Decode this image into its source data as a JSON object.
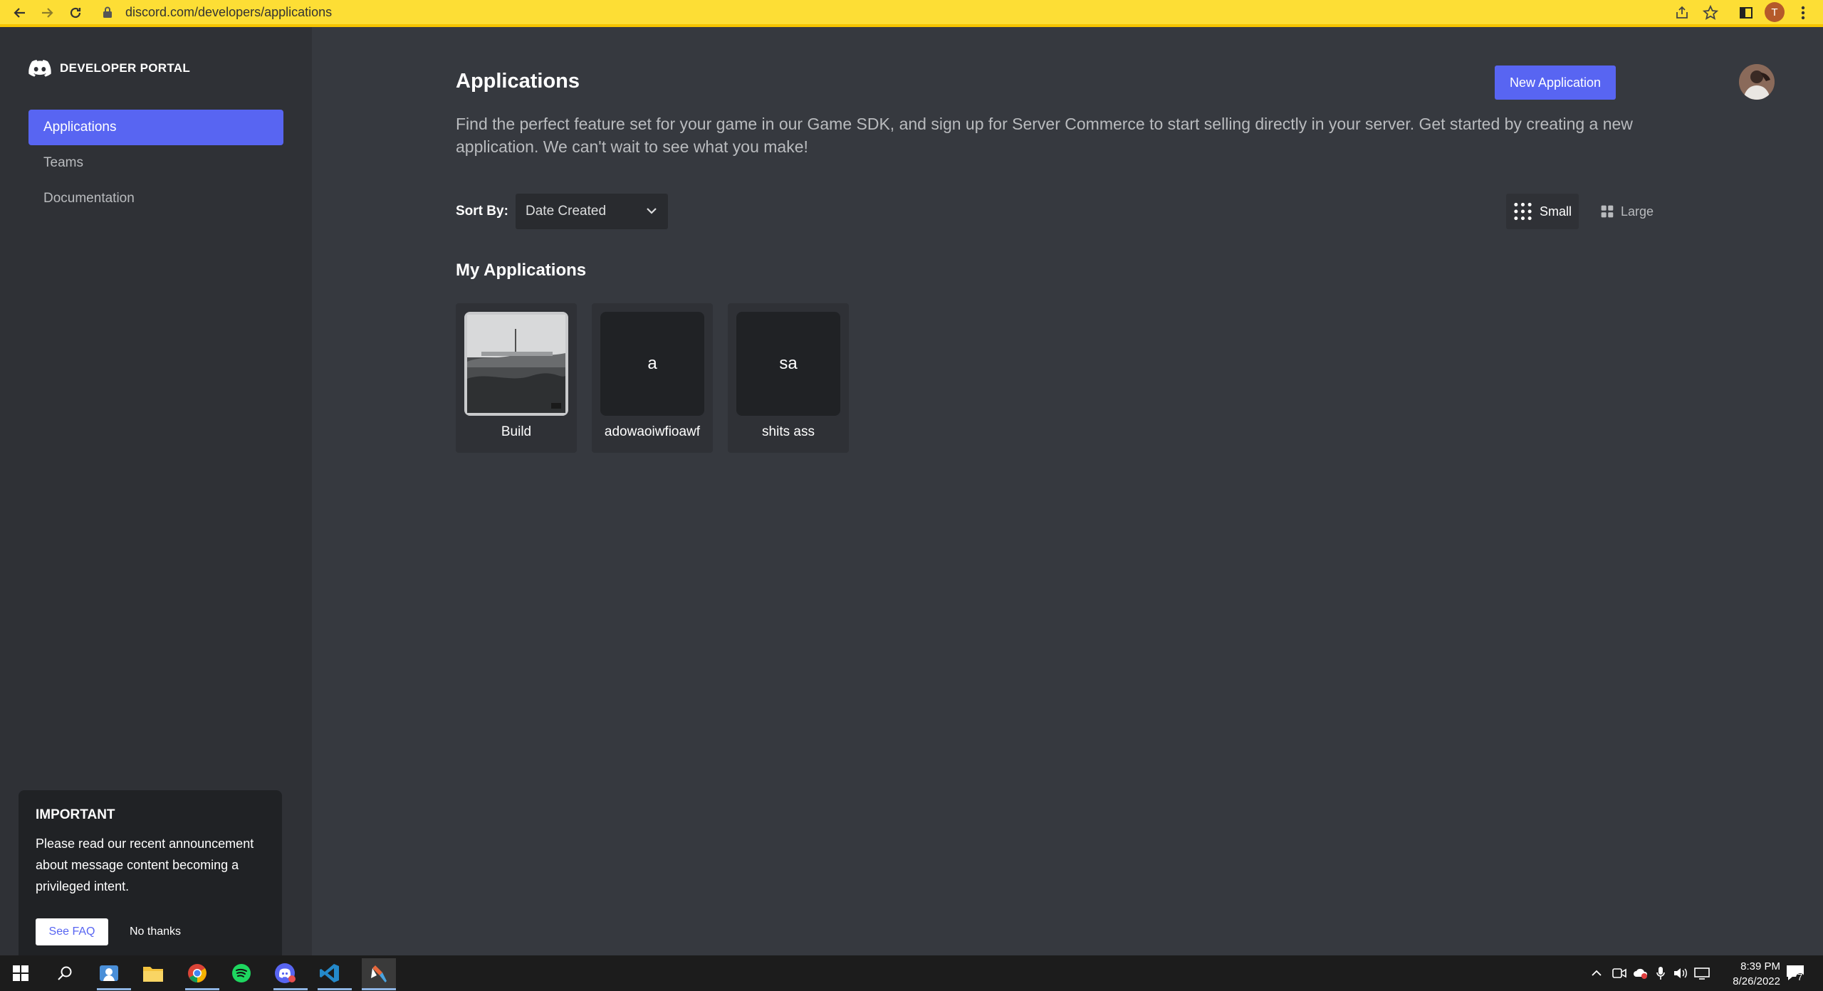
{
  "browser": {
    "url": "discord.com/developers/applications",
    "profile_initial": "T"
  },
  "sidebar": {
    "brand": "DEVELOPER PORTAL",
    "items": [
      {
        "label": "Applications",
        "active": true
      },
      {
        "label": "Teams",
        "active": false
      },
      {
        "label": "Documentation",
        "active": false
      }
    ],
    "notice": {
      "title": "IMPORTANT",
      "body": "Please read our recent announcement about message content becoming a privileged intent.",
      "primary_label": "See FAQ",
      "secondary_label": "No thanks"
    }
  },
  "main": {
    "title": "Applications",
    "new_app_label": "New Application",
    "intro": "Find the perfect feature set for your game in our Game SDK, and sign up for Server Commerce to start selling directly in your server. Get started by creating a new application. We can't wait to see what you make!",
    "sort_label": "Sort By:",
    "sort_value": "Date Created",
    "view_small_label": "Small",
    "view_large_label": "Large",
    "section_title": "My Applications",
    "apps": [
      {
        "name": "Build",
        "initials": "",
        "has_image": true
      },
      {
        "name": "adowaoiwfioawf",
        "initials": "a",
        "has_image": false
      },
      {
        "name": "shits ass",
        "initials": "sa",
        "has_image": false
      }
    ]
  },
  "taskbar": {
    "time": "8:39 PM",
    "date": "8/26/2022",
    "notification_count": "7"
  },
  "colors": {
    "accent": "#5865f2",
    "sidebar_bg": "#2f3136",
    "main_bg": "#36393f",
    "browser_bar": "#fdde35"
  }
}
